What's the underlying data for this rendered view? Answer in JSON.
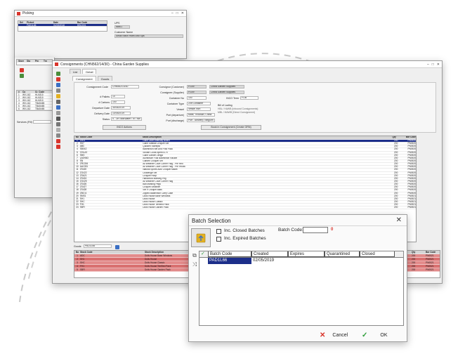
{
  "picking_window": {
    "title": "Picking",
    "grid_headers": [
      "Sel",
      "Picked",
      "Date",
      "Bar Code"
    ],
    "grid_row": [
      "",
      "PAD1L66",
      "01/08/2018",
      "BIN1001"
    ],
    "ups_label": "UPS",
    "ups_value": "NM01",
    "customer_label": "Customer Name",
    "customer_value": "Small Stitch Hotel And Spa"
  },
  "side_window": {
    "headers": [
      "Store",
      "Sta",
      "Pm",
      "Tm"
    ],
    "list_headers": [
      "#",
      "Co",
      "In",
      "Cr. Code"
    ],
    "rows": [
      [
        "1",
        "WV-162",
        "HLN310"
      ],
      [
        "2",
        "WV-162",
        "HLN310"
      ],
      [
        "3",
        "WV-162",
        "HLN310"
      ],
      [
        "4",
        "WV-162",
        "TBA5465"
      ],
      [
        "5",
        "WV-162",
        "TBA5465"
      ],
      [
        "6",
        "WV-162",
        "TBA5465"
      ]
    ],
    "services_label": "Services (Fill)"
  },
  "main_window": {
    "title": "Consignments (CHN562/14/30) - China Garden Supplies",
    "tabs": [
      "List",
      "Detail"
    ],
    "subtabs": [
      "Consignment",
      "Goods"
    ],
    "form": {
      "consignment_code_label": "Consignment Code",
      "consignment_code": "CHN562/14/30",
      "pallets_label": "# Pallets",
      "pallets": "10",
      "cartons_label": "# Cartons",
      "cartons": "100",
      "departure_label": "Departure Date",
      "departure": "30/04/2019",
      "delivery_label": "Delivery Date",
      "delivery": "10/05/2019",
      "status_label": "Status",
      "status": "5 - On Sea/Water / In Tran",
      "consignor_label": "Consignor (Customer)",
      "consignor_code": "FG09",
      "consignor_name": "China Garden Supplies",
      "consignee_label": "Consignee (Supplier)",
      "consignee_code": "FG09",
      "consignee_name": "China Garden Supplies",
      "container_label": "Container No",
      "container": "100",
      "container_type_label": "Container Type",
      "container_type": "20ft Container",
      "vessel_label": "Vessel",
      "vessel": "Vessel Inch",
      "port_departure_label": "Port (departure)",
      "port_departure": "Mark, Thousan, China",
      "port_discharge_label": "Port (discharge)",
      "port_discharge": "Port - Antwerp, Belgium",
      "incoterm_label": "INCO Term",
      "incoterm": "FOB",
      "bill_label": "Bill of Lading",
      "bill_option_1": "HBL / HAWB (Inbound Consignments)",
      "bill_option_2": "MBL / MAWB (Direct Consignment)",
      "inco_actions_label": "INCO Actions",
      "book_label": "Book in Consignment (Create GRN)"
    },
    "grid_headers": [
      "No",
      "Stock Code",
      "Stock Description",
      "Qty",
      "Bar Code"
    ],
    "grid_rows": [
      [
        "1",
        "LB01",
        "Giant Lawn Intensity Board",
        "200",
        "PN0520"
      ],
      [
        "2",
        "SS7",
        "Giant Softball Croquet Set",
        "200",
        "PN0520"
      ],
      [
        "3",
        "ABC",
        "Quillzen Sweepst",
        "200",
        "PN0520"
      ],
      [
        "4",
        "SB042",
        "Badminton Net And Post Pack",
        "200",
        "PN0520"
      ],
      [
        "5",
        "CHLA3",
        "Shuttle Cocks speed 079",
        "200",
        "PN0520"
      ],
      [
        "6",
        "SBG",
        "Giant Garden Jenga",
        "200",
        "PN0520"
      ],
      [
        "7",
        "LA0NN3",
        "Aluminium Fold Badminton Racket",
        "200",
        "PN0520"
      ],
      [
        "8",
        "SN",
        "Garden Croquet Set",
        "200",
        "PN0520"
      ],
      [
        "9",
        "ZR1394",
        "All Weather Court Corner Flag - Pre Red",
        "200",
        "PN0520"
      ],
      [
        "10",
        "AA1351",
        "All Weather Court Corner Flag - Pre Yellow",
        "200",
        "PN0520"
      ],
      [
        "11",
        "ZS420",
        "Natural Sports Auto Croquet Mallet",
        "200",
        "PN0520"
      ],
      [
        "12",
        "ZG422",
        "Challenge Set",
        "200",
        "PN0520"
      ],
      [
        "13",
        "ZSA21",
        "Croquet Hoop",
        "200",
        "PN0520"
      ],
      [
        "14",
        "ZS424",
        "Hardwood Marking Peg",
        "200",
        "PN0520"
      ],
      [
        "15",
        "ZG425",
        "All Weather Court Corner Flag",
        "200",
        "PN0520"
      ],
      [
        "16",
        "ZS426",
        "Ball Marking Pegs",
        "200",
        "PN0520"
      ],
      [
        "17",
        "ZS427",
        "Croquet Smasher",
        "200",
        "PN0520"
      ],
      [
        "18",
        "ZS428",
        "Set 9 Croquet Balls",
        "200",
        "PN0520"
      ],
      [
        "19",
        "ZBC11",
        "Zipped Badminton Carry Case",
        "200",
        "PN0520"
      ],
      [
        "20",
        "SMS1",
        "Dolls House Base Windows",
        "200",
        "PN0521"
      ],
      [
        "21",
        "SH1",
        "Dolls House",
        "200",
        "PN0521"
      ],
      [
        "22",
        "SHC",
        "Dolls House Classic",
        "200",
        "PN0521"
      ],
      [
        "23",
        "FH1",
        "Dolls House Terrified Pack",
        "200",
        "PN0521"
      ],
      [
        "24",
        "SBFI",
        "Dolls House Garden Pack",
        "200",
        "PN0521"
      ]
    ],
    "filter_label": "Goods",
    "filter_value": "PAD1L66",
    "bottom_headers": [
      "No",
      "Stock Code",
      "Stock Description",
      "Qty",
      "Bar Code"
    ],
    "bottom_rows": [
      [
        "1",
        "ADC",
        "Dolls House Base Windows",
        "200",
        "PN0521"
      ],
      [
        "2",
        "SH1",
        "Dolls House",
        "200",
        "PN0521"
      ],
      [
        "3",
        "SHC",
        "Dolls House Classic",
        "200",
        "PN0521"
      ],
      [
        "4",
        "FH1",
        "Dolls House Terrified Pack",
        "200",
        "PN0521"
      ],
      [
        "5",
        "SBFI",
        "Dolls House Garden Pack",
        "200",
        "PN0521"
      ]
    ]
  },
  "batch_dialog": {
    "title": "Batch Selection",
    "close_glyph": "✕",
    "inc_closed_label": "Inc. Closed Batches",
    "inc_expired_label": "Inc. Expired Batches",
    "batch_code_label": "Batch Code:",
    "batch_code_value": "",
    "batch_count": "0",
    "columns": [
      "Batch Code",
      "Created",
      "Expires",
      "Quarantined",
      "Closed"
    ],
    "rows": [
      {
        "batch_code": "PAD1L66",
        "created": "02/05/2019",
        "expires": "",
        "quarantined": "",
        "closed": ""
      }
    ],
    "cancel_label": "Cancel",
    "ok_label": "OK"
  },
  "colors": {
    "selection": "#1d2f8a",
    "cancel_red": "#d9352c",
    "ok_green": "#2e9e3a",
    "row_highlight": "#e28a8a"
  }
}
